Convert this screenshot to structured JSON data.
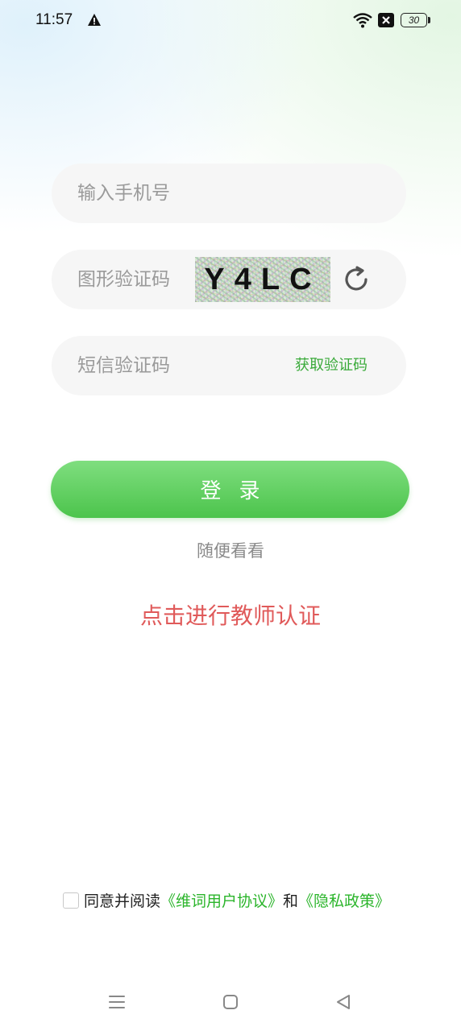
{
  "status_bar": {
    "time": "11:57",
    "battery": "30",
    "icons": [
      "warning-icon",
      "wifi-icon",
      "no-sim-icon",
      "battery-icon"
    ]
  },
  "form": {
    "phone_placeholder": "输入手机号",
    "captcha_placeholder": "图形验证码",
    "captcha_text": "Y4LC",
    "sms_placeholder": "短信验证码",
    "get_code_label": "获取验证码"
  },
  "login_label": "登录",
  "browse_label": "随便看看",
  "teacher_link": "点击进行教师认证",
  "agreement": {
    "prefix": "同意并阅读",
    "user_agreement": "《维词用户协议》",
    "and": "和",
    "privacy_policy": "《隐私政策》"
  },
  "colors": {
    "accent_green": "#4cc44c",
    "link_green": "#2bb52b",
    "teacher_red": "#e05a5a"
  }
}
